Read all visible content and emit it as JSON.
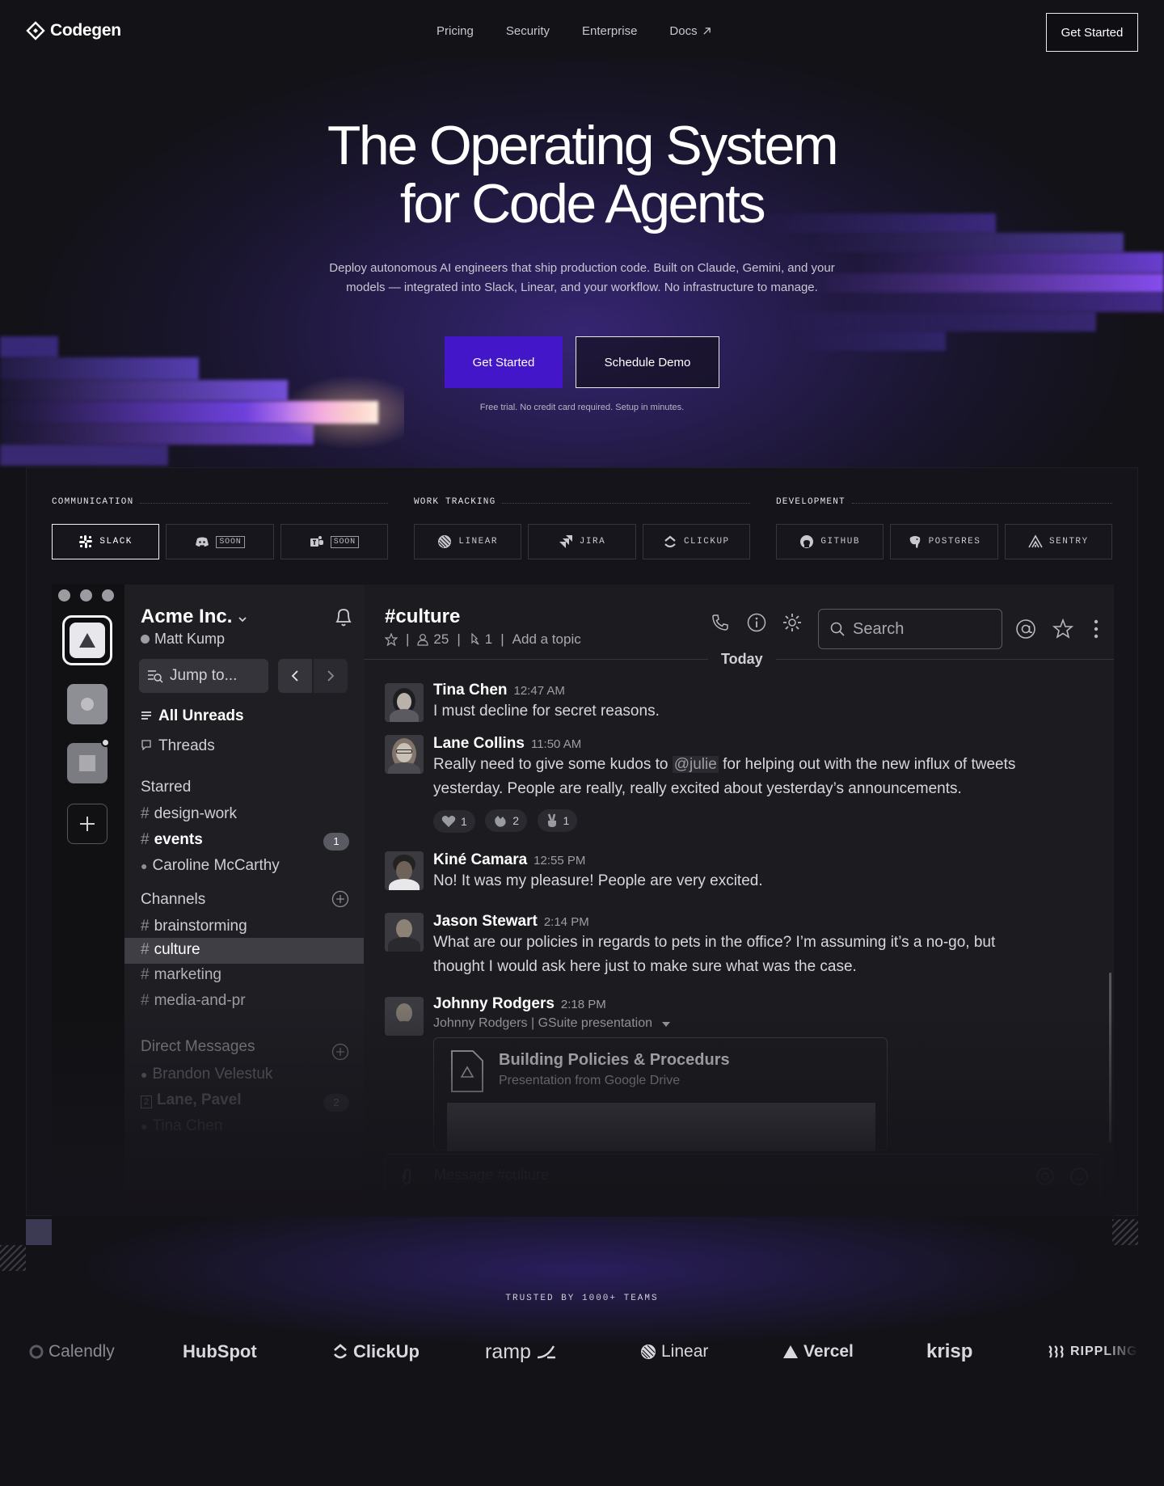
{
  "brand": {
    "name": "Codegen",
    "accent": "#4316c9"
  },
  "nav": {
    "links": [
      "Pricing",
      "Security",
      "Enterprise",
      "Docs"
    ],
    "docs_icon": "arrow-up-right-icon",
    "cta": "Get Started"
  },
  "hero": {
    "title_line1": "The Operating System",
    "title_line2": "for Code Agents",
    "subtitle_line1": "Deploy autonomous AI engineers that ship production code. Built on Claude, Gemini, and your",
    "subtitle_line2": "models — integrated into Slack, Linear, and your workflow. No infrastructure to manage.",
    "primary_cta": "Get Started",
    "secondary_cta": "Schedule Demo",
    "note": "Free trial. No credit card required. Setup in minutes."
  },
  "integrations": {
    "communication": {
      "heading": "COMMUNICATION",
      "items": [
        {
          "label": "SLACK",
          "icon": "slack-icon",
          "active": true
        },
        {
          "label": "SOON",
          "icon": "discord-icon",
          "soon": true
        },
        {
          "label": "SOON",
          "icon": "teams-icon",
          "soon": true
        }
      ]
    },
    "work_tracking": {
      "heading": "WORK TRACKING",
      "items": [
        {
          "label": "LINEAR",
          "icon": "linear-icon"
        },
        {
          "label": "JIRA",
          "icon": "jira-icon"
        },
        {
          "label": "CLICKUP",
          "icon": "clickup-icon"
        }
      ]
    },
    "development": {
      "heading": "DEVELOPMENT",
      "items": [
        {
          "label": "GITHUB",
          "icon": "github-icon"
        },
        {
          "label": "POSTGRES",
          "icon": "postgres-icon"
        },
        {
          "label": "SENTRY",
          "icon": "sentry-icon"
        }
      ]
    }
  },
  "slack": {
    "workspace": "Acme Inc.",
    "user": "Matt Kump",
    "jump_placeholder": "Jump to...",
    "all_unreads": "All Unreads",
    "threads": "Threads",
    "starred_heading": "Starred",
    "starred": [
      {
        "prefix": "#",
        "name": "design-work"
      },
      {
        "prefix": "#",
        "name": "events",
        "badge": "1"
      },
      {
        "prefix": "●",
        "name": "Caroline McCarthy"
      }
    ],
    "channels_heading": "Channels",
    "channels": [
      "brainstorming",
      "culture",
      "marketing",
      "media-and-pr"
    ],
    "dm_heading": "Direct Messages",
    "dms": [
      {
        "name": "Brandon Velestuk"
      },
      {
        "name": "Lane, Pavel",
        "badge": "2"
      },
      {
        "name": "Tina Chen"
      }
    ],
    "channel": {
      "name": "#culture",
      "members": "25",
      "pins": "1",
      "topic": "Add a topic",
      "search": "Search",
      "day": "Today",
      "composer": "Message #culture"
    },
    "messages": [
      {
        "name": "Tina Chen",
        "time": "12:47 AM",
        "text": "I must decline for secret reasons."
      },
      {
        "name": "Lane Collins",
        "time": "11:50 AM",
        "text_before": "Really need to give some kudos to",
        "mention": "@julie",
        "text_after": "for helping out with the new influx of tweets",
        "text_line2": "yesterday. People are really, really excited about yesterday’s announcements.",
        "reactions": [
          {
            "icon": "heart-icon",
            "count": "1"
          },
          {
            "icon": "clap-icon",
            "count": "2"
          },
          {
            "icon": "peace-icon",
            "count": "1"
          }
        ]
      },
      {
        "name": "Kiné Camara",
        "time": "12:55 PM",
        "text": "No! It was my pleasure! People are very excited."
      },
      {
        "name": "Jason Stewart",
        "time": "2:14 PM",
        "text": "What are our policies in regards to pets in the office? I’m assuming it’s a no-go, but",
        "text_line2": "thought I would ask here just to make sure what was the case."
      },
      {
        "name": "Johnny Rodgers",
        "time": "2:18 PM",
        "subline": "Johnny Rodgers | GSuite presentation",
        "attachment_title": "Building Policies & Procedurs",
        "attachment_sub": "Presentation from Google Drive"
      }
    ]
  },
  "trusted": {
    "heading": "TRUSTED BY 1000+ TEAMS",
    "logos": [
      "Calendly",
      "HubSpot",
      "ClickUp",
      "ramp",
      "Linear",
      "Vercel",
      "krisp",
      "RIPPLING"
    ]
  }
}
